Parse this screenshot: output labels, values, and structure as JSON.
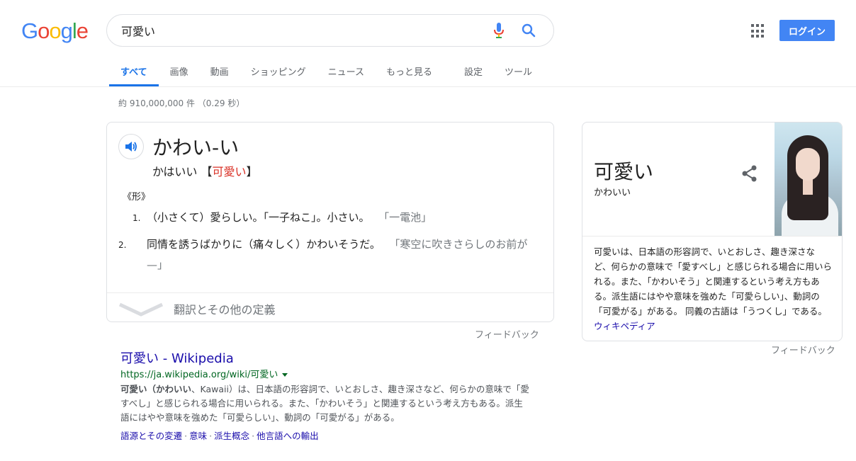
{
  "logo": {
    "letters": [
      "G",
      "o",
      "o",
      "g",
      "l",
      "e"
    ],
    "colors": [
      "#4285f4",
      "#ea4335",
      "#fbbc05",
      "#4285f4",
      "#34a853",
      "#ea4335"
    ]
  },
  "search": {
    "query": "可愛い"
  },
  "header": {
    "login_label": "ログイン"
  },
  "tabs": [
    {
      "label": "すべて"
    },
    {
      "label": "画像"
    },
    {
      "label": "動画"
    },
    {
      "label": "ショッピング"
    },
    {
      "label": "ニュース"
    },
    {
      "label": "もっと見る"
    },
    {
      "label": "設定"
    },
    {
      "label": "ツール"
    }
  ],
  "stats": "約 910,000,000 件 （0.29 秒）",
  "dictionary": {
    "headword": "かわい-い",
    "reading_prefix": "かはいい 【",
    "reading_kanji": "可愛い",
    "reading_suffix": "】",
    "pos": "《形》",
    "definitions": [
      {
        "num": "1.",
        "text": "（小さくて）愛らしい。「一子ねこ」。小さい。",
        "example": "「一電池」"
      },
      {
        "num": "2.",
        "text": "同情を誘うばかりに（痛々しく）かわいそうだ。",
        "example": "「寒空に吹きさらしのお前が—」"
      }
    ],
    "more_label": "翻訳とその他の定義"
  },
  "feedback_label": "フィードバック",
  "result": {
    "title": "可愛い - Wikipedia",
    "url": "https://ja.wikipedia.org/wiki/可愛い",
    "snippet_bold": "可愛い（かわいい",
    "snippet_rest": "、Kawaii）は、日本語の形容詞で、いとおしさ、趣き深さなど、何らかの意味で「愛すべし」と感じられる場合に用いられる。また、「かわいそう」と関連するという考え方もある。派生語にはやや意味を強めた「可愛らしい」、動詞の「可愛がる」がある。",
    "sublinks": [
      "語源とその変遷",
      "意味",
      "派生概念",
      "他言語への輸出"
    ]
  },
  "knowledge_panel": {
    "title": "可愛い",
    "subtitle": "かわいい",
    "description": "可愛いは、日本語の形容詞で、いとおしさ、趣き深さなど、何らかの意味で「愛すべし」と感じられる場合に用いられる。また、「かわいそう」と関連するという考え方もある。派生語にはやや意味を強めた「可愛らしい」、動詞の「可愛がる」がある。 同義の古語は「うつくし」である。",
    "source": "ウィキペディア"
  }
}
